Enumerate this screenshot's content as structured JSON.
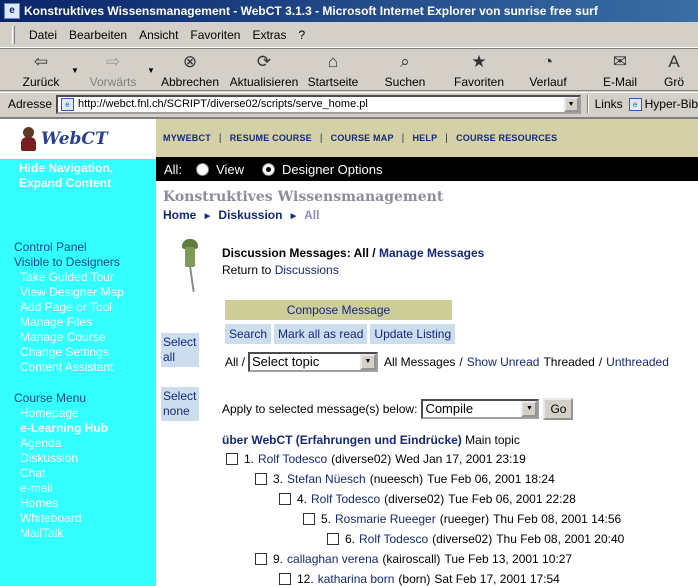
{
  "window": {
    "title": "Konstruktives Wissensmanagement - WebCT 3.1.3 - Microsoft Internet Explorer von sunrise free surf"
  },
  "menu": [
    "Datei",
    "Bearbeiten",
    "Ansicht",
    "Favoriten",
    "Extras",
    "?"
  ],
  "toolbar": {
    "back": "Zurück",
    "forward": "Vorwärts",
    "stop": "Abbrechen",
    "refresh": "Aktualisieren",
    "home": "Startseite",
    "search": "Suchen",
    "favorites": "Favoriten",
    "history": "Verlauf",
    "mail": "E-Mail",
    "size": "Grö"
  },
  "address": {
    "label": "Adresse",
    "url": "http://webct.fnl.ch/SCRIPT/diverse02/scripts/serve_home.pl",
    "links": "Links",
    "link1": "Hyper-Bib"
  },
  "logo": "WebCT",
  "sidebar": {
    "toggle": "Hide Navigation, Expand Content",
    "control_title": "Control Panel",
    "visible_title": "Visible to Designers",
    "control_items": [
      "Take Guided Tour",
      "View Designer Map",
      "Add Page or Tool",
      "Manage Files",
      "Manage Course",
      "Change Settings",
      "Content Assistant"
    ],
    "course_menu_title": "Course Menu",
    "course_items": [
      "Homepage",
      "e-Learning Hub",
      "Agenda",
      "Diskussion",
      "Chat",
      "e-mail",
      "Homes",
      "Whiteboard",
      "MailTalk"
    ]
  },
  "topnav": [
    "MYWEBCT",
    "RESUME COURSE",
    "COURSE MAP",
    "HELP",
    "COURSE RESOURCES"
  ],
  "mode": {
    "all": "All:",
    "view": "View",
    "designer": "Designer Options"
  },
  "course": {
    "title": "Konstruktives Wissensmanagement",
    "crumb_home": "Home",
    "crumb_disc": "Diskussion",
    "crumb_all": "All"
  },
  "discussion": {
    "heading": "Discussion Messages: All /",
    "manage": "Manage Messages",
    "return_prefix": "Return to",
    "return_link": "Discussions",
    "compose": "Compose Message",
    "search": "Search",
    "mark_all": "Mark all as read",
    "update": "Update Listing",
    "select_all": "Select all",
    "select_none": "Select none",
    "all_prefix": "All /",
    "topic_select": "Select topic",
    "all_messages": "All Messages",
    "show_unread": "Show Unread",
    "threaded": "Threaded",
    "unthreaded": "Unthreaded",
    "apply_label": "Apply to selected message(s) below:",
    "apply_select": "Compile",
    "go": "Go",
    "topic_name": "über WebCT (Erfahrungen und Eindrücke)",
    "topic_type": "Main topic"
  },
  "messages": [
    {
      "num": "1.",
      "author": "Rolf Todesco",
      "user": "(diverse02)",
      "date": "Wed Jan 17, 2001 23:19"
    },
    {
      "num": "3.",
      "author": "Stefan Nüesch",
      "user": "(nueesch)",
      "date": "Tue Feb 06, 2001 18:24"
    },
    {
      "num": "4.",
      "author": "Rolf Todesco",
      "user": "(diverse02)",
      "date": "Tue Feb 06, 2001 22:28"
    },
    {
      "num": "5.",
      "author": "Rosmarie Rueeger",
      "user": "(rueeger)",
      "date": "Thu Feb 08, 2001 14:56"
    },
    {
      "num": "6.",
      "author": "Rolf Todesco",
      "user": "(diverse02)",
      "date": "Thu Feb 08, 2001 20:40"
    },
    {
      "num": "9.",
      "author": "callaghan verena",
      "user": "(kairoscall)",
      "date": "Tue Feb 13, 2001 10:27"
    },
    {
      "num": "12.",
      "author": "katharina born",
      "user": "(born)",
      "date": "Sat Feb 17, 2001 17:54"
    }
  ]
}
